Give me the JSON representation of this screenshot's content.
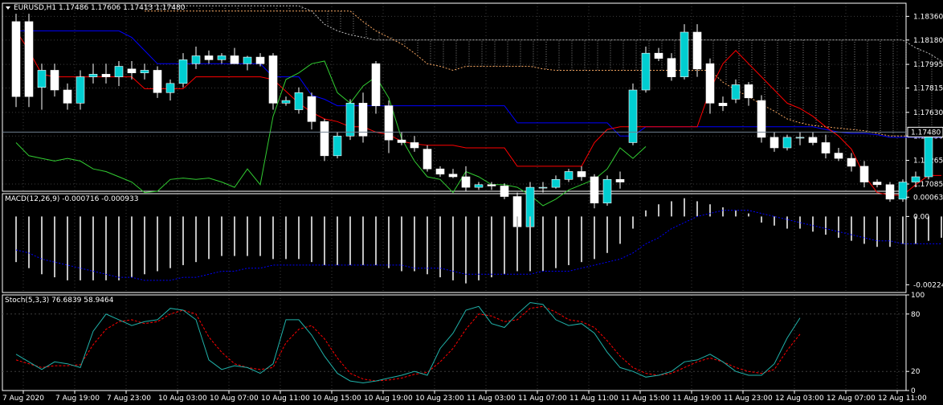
{
  "main": {
    "symbol_header": "EURUSD,H1  1.17486 1.17606 1.17413 1.17480",
    "price_ticks": [
      "1.18360",
      "1.18180",
      "1.17995",
      "1.17815",
      "1.17630",
      "1.17450",
      "1.17265",
      "1.17085"
    ],
    "current_price": "1.17480",
    "ylim": [
      1.1703,
      1.1846
    ]
  },
  "macd": {
    "header": "MACD(12,26,9) -0.000716 -0.000933",
    "ticks": [
      "0.000635",
      "0.00",
      "-0.002245"
    ],
    "ylim": [
      -0.0025,
      0.00075
    ]
  },
  "stoch": {
    "header": "Stoch(5,3,3) 76.6839 58.9464",
    "ticks": [
      "100",
      "80",
      "20",
      "0"
    ],
    "ylim": [
      0,
      100
    ]
  },
  "time_labels": [
    "7 Aug 2020",
    "7 Aug 19:00",
    "7 Aug 23:00",
    "10 Aug 03:00",
    "10 Aug 07:00",
    "10 Aug 11:00",
    "10 Aug 15:00",
    "10 Aug 19:00",
    "10 Aug 23:00",
    "11 Aug 03:00",
    "11 Aug 07:00",
    "11 Aug 11:00",
    "11 Aug 15:00",
    "11 Aug 19:00",
    "11 Aug 23:00",
    "12 Aug 03:00",
    "12 Aug 07:00",
    "12 Aug 11:00"
  ],
  "colors": {
    "background": "#000000",
    "frame": "#ffffff",
    "grid": "#3c3c3c",
    "bull_candle": "#00ced1",
    "bear_candle": "#ffffff",
    "tenkan": "#ff0000",
    "kijun": "#0000ff",
    "chikou": "#32cd32",
    "senkou_a": "#f4a460",
    "senkou_b": "#c0c0c0",
    "macd_hist": "#c0c0c0",
    "macd_signal": "#0000ff",
    "stoch_main": "#20b2aa",
    "stoch_signal": "#ff0000",
    "price_line": "#708090"
  },
  "chart_data": [
    {
      "type": "candlestick",
      "title": "EURUSD,H1",
      "ohlc": [
        [
          1.1832,
          1.1838,
          1.1767,
          1.1775
        ],
        [
          1.1832,
          1.1838,
          1.1767,
          1.1775
        ],
        [
          1.1782,
          1.18,
          1.1765,
          1.1795
        ],
        [
          1.1795,
          1.18,
          1.1775,
          1.178
        ],
        [
          1.178,
          1.1785,
          1.1765,
          1.177
        ],
        [
          1.177,
          1.1795,
          1.1765,
          1.179
        ],
        [
          1.179,
          1.18,
          1.1785,
          1.1792
        ],
        [
          1.1792,
          1.18,
          1.1785,
          1.179
        ],
        [
          1.179,
          1.1802,
          1.1783,
          1.1798
        ],
        [
          1.1796,
          1.1802,
          1.1788,
          1.1793
        ],
        [
          1.1793,
          1.18,
          1.1788,
          1.1795
        ],
        [
          1.1795,
          1.1798,
          1.1774,
          1.1778
        ],
        [
          1.1778,
          1.1788,
          1.1772,
          1.1785
        ],
        [
          1.1785,
          1.1808,
          1.1782,
          1.1803
        ],
        [
          1.18,
          1.1813,
          1.1796,
          1.1806
        ],
        [
          1.1806,
          1.181,
          1.18,
          1.1803
        ],
        [
          1.1803,
          1.1808,
          1.18,
          1.1806
        ],
        [
          1.1806,
          1.1812,
          1.18,
          1.18
        ],
        [
          1.18,
          1.1806,
          1.1795,
          1.1805
        ],
        [
          1.1805,
          1.1808,
          1.1798,
          1.18
        ],
        [
          1.1806,
          1.1808,
          1.1765,
          1.177
        ],
        [
          1.177,
          1.1775,
          1.1768,
          1.1772
        ],
        [
          1.1765,
          1.1782,
          1.1762,
          1.1778
        ],
        [
          1.1775,
          1.1778,
          1.175,
          1.1756
        ],
        [
          1.1756,
          1.1758,
          1.1726,
          1.173
        ],
        [
          1.173,
          1.1748,
          1.1728,
          1.1745
        ],
        [
          1.1745,
          1.1773,
          1.1742,
          1.177
        ],
        [
          1.177,
          1.1778,
          1.174,
          1.1745
        ],
        [
          1.18,
          1.1802,
          1.1762,
          1.1768
        ],
        [
          1.1768,
          1.1772,
          1.1732,
          1.1742
        ],
        [
          1.1742,
          1.1748,
          1.1738,
          1.174
        ],
        [
          1.174,
          1.1745,
          1.1733,
          1.1736
        ],
        [
          1.1735,
          1.1738,
          1.1718,
          1.172
        ],
        [
          1.172,
          1.1722,
          1.1714,
          1.1716
        ],
        [
          1.1716,
          1.172,
          1.1713,
          1.1714
        ],
        [
          1.1714,
          1.1722,
          1.1703,
          1.1706
        ],
        [
          1.1706,
          1.171,
          1.1704,
          1.1708
        ],
        [
          1.1708,
          1.171,
          1.1704,
          1.1707
        ],
        [
          1.1707,
          1.1709,
          1.1697,
          1.1699
        ],
        [
          1.1699,
          1.1702,
          1.1672,
          1.1676
        ],
        [
          1.1676,
          1.171,
          1.1674,
          1.1706
        ],
        [
          1.1706,
          1.171,
          1.1702,
          1.1706
        ],
        [
          1.1706,
          1.1715,
          1.1705,
          1.1712
        ],
        [
          1.1712,
          1.172,
          1.171,
          1.1718
        ],
        [
          1.1718,
          1.1722,
          1.1711,
          1.1714
        ],
        [
          1.1714,
          1.1716,
          1.169,
          1.1694
        ],
        [
          1.1694,
          1.1715,
          1.1692,
          1.1712
        ],
        [
          1.1712,
          1.1718,
          1.1705,
          1.171
        ],
        [
          1.174,
          1.1785,
          1.1738,
          1.178
        ],
        [
          1.178,
          1.1813,
          1.1778,
          1.1808
        ],
        [
          1.1808,
          1.1812,
          1.1802,
          1.1804
        ],
        [
          1.1804,
          1.1808,
          1.1787,
          1.179
        ],
        [
          1.179,
          1.183,
          1.1788,
          1.1824
        ],
        [
          1.1824,
          1.183,
          1.179,
          1.1796
        ],
        [
          1.18,
          1.1804,
          1.1762,
          1.177
        ],
        [
          1.177,
          1.1775,
          1.1764,
          1.1768
        ],
        [
          1.1773,
          1.1788,
          1.177,
          1.1784
        ],
        [
          1.1784,
          1.1786,
          1.1768,
          1.1774
        ],
        [
          1.1772,
          1.1776,
          1.174,
          1.1744
        ],
        [
          1.1744,
          1.1748,
          1.1733,
          1.1736
        ],
        [
          1.1736,
          1.1746,
          1.1734,
          1.1744
        ],
        [
          1.1744,
          1.1748,
          1.1738,
          1.1744
        ],
        [
          1.1744,
          1.1748,
          1.1738,
          1.174
        ],
        [
          1.174,
          1.1746,
          1.1728,
          1.1732
        ],
        [
          1.1732,
          1.1736,
          1.1726,
          1.1728
        ],
        [
          1.1728,
          1.1732,
          1.1718,
          1.1722
        ],
        [
          1.1722,
          1.1726,
          1.1706,
          1.171
        ],
        [
          1.171,
          1.1712,
          1.1706,
          1.1708
        ],
        [
          1.1708,
          1.171,
          1.1695,
          1.1697
        ],
        [
          1.1697,
          1.1712,
          1.1695,
          1.171
        ],
        [
          1.171,
          1.1718,
          1.1706,
          1.1714
        ],
        [
          1.1714,
          1.1752,
          1.1712,
          1.1748
        ],
        [
          1.1748,
          1.1752,
          1.1745,
          1.1749
        ]
      ],
      "tenkan": [
        1.1825,
        1.181,
        1.1792,
        1.179,
        1.179,
        1.179,
        1.179,
        1.179,
        1.179,
        1.179,
        1.1781,
        1.1781,
        1.1781,
        1.1781,
        1.179,
        1.179,
        1.179,
        1.179,
        1.179,
        1.179,
        1.1788,
        1.1779,
        1.177,
        1.1763,
        1.1758,
        1.1756,
        1.1752,
        1.1752,
        1.1748,
        1.1746,
        1.1741,
        1.1739,
        1.1738,
        1.1738,
        1.1738,
        1.1736,
        1.1736,
        1.1736,
        1.1736,
        1.1722,
        1.1722,
        1.1722,
        1.1722,
        1.1722,
        1.1722,
        1.174,
        1.175,
        1.1752,
        1.1752,
        1.1752,
        1.1752,
        1.1752,
        1.1752,
        1.1752,
        1.178,
        1.18,
        1.181,
        1.18,
        1.179,
        1.178,
        1.177,
        1.1766,
        1.176,
        1.1752,
        1.1745,
        1.1735,
        1.1715,
        1.1702,
        1.17,
        1.17,
        1.1708,
        1.1715,
        1.1715
      ],
      "kijun": [
        1.1825,
        1.1825,
        1.1825,
        1.1825,
        1.1825,
        1.1825,
        1.1825,
        1.1825,
        1.1825,
        1.182,
        1.181,
        1.18,
        1.18,
        1.18,
        1.18,
        1.18,
        1.18,
        1.18,
        1.18,
        1.18,
        1.179,
        1.179,
        1.179,
        1.1776,
        1.1773,
        1.1768,
        1.1768,
        1.1768,
        1.1768,
        1.1768,
        1.1768,
        1.1768,
        1.1768,
        1.1768,
        1.1768,
        1.1768,
        1.1768,
        1.1768,
        1.1768,
        1.1755,
        1.1755,
        1.1755,
        1.1755,
        1.1755,
        1.1755,
        1.1755,
        1.1755,
        1.1745,
        1.1745,
        1.1752,
        1.1752,
        1.1752,
        1.1752,
        1.1752,
        1.1752,
        1.1752,
        1.1752,
        1.1752,
        1.1752,
        1.1752,
        1.1752,
        1.1752,
        1.1752,
        1.175,
        1.1748,
        1.1747,
        1.1747,
        1.1746,
        1.1744,
        1.1744,
        1.1744,
        1.1744,
        1.1744
      ],
      "chikou": [
        1.174,
        1.173,
        1.1728,
        1.1726,
        1.1728,
        1.1726,
        1.172,
        1.1718,
        1.1714,
        1.171,
        1.1702,
        1.1703,
        1.1712,
        1.1713,
        1.1712,
        1.1713,
        1.171,
        1.1706,
        1.172,
        1.1708,
        1.176,
        1.1788,
        1.1793,
        1.18,
        1.1802,
        1.1778,
        1.177,
        1.1783,
        1.179,
        1.1774,
        1.1743,
        1.1726,
        1.1714,
        1.1712,
        1.1702,
        1.1718,
        1.1714,
        1.1708,
        1.1708,
        1.1706,
        1.17,
        1.1692,
        1.1697,
        1.1704,
        1.1708,
        1.1712,
        1.172,
        1.1736,
        1.1728,
        1.1737
      ],
      "senkou_a": [
        null,
        null,
        null,
        null,
        null,
        null,
        null,
        null,
        null,
        null,
        1.184,
        1.184,
        1.184,
        1.184,
        1.184,
        1.184,
        1.184,
        1.184,
        1.184,
        1.184,
        1.184,
        1.184,
        1.184,
        1.184,
        1.184,
        1.184,
        1.184,
        1.1832,
        1.1825,
        1.182,
        1.1815,
        1.1808,
        1.18,
        1.1798,
        1.1795,
        1.1798,
        1.1798,
        1.1798,
        1.1798,
        1.1798,
        1.1798,
        1.1796,
        1.1795,
        1.1795,
        1.1795,
        1.1795,
        1.1795,
        1.1795,
        1.1795,
        1.1795,
        1.1795,
        1.1795,
        1.1795,
        1.1795,
        1.1795,
        1.1786,
        1.178,
        1.1775,
        1.1769,
        1.1764,
        1.1758,
        1.1755,
        1.1753,
        1.1752,
        1.1751,
        1.175,
        1.1749,
        1.1747,
        1.1745,
        1.1745,
        1.1745,
        1.1746,
        1.1748,
        1.175
      ],
      "senkou_b": [
        null,
        null,
        null,
        null,
        null,
        null,
        null,
        null,
        null,
        null,
        1.1844,
        1.1844,
        1.1844,
        1.1844,
        1.1844,
        1.1844,
        1.1844,
        1.1844,
        1.1844,
        1.1844,
        1.1844,
        1.1844,
        1.1844,
        1.184,
        1.183,
        1.1825,
        1.1822,
        1.182,
        1.1818,
        1.1818,
        1.1818,
        1.1818,
        1.1818,
        1.1818,
        1.1818,
        1.1818,
        1.1818,
        1.1818,
        1.1818,
        1.1818,
        1.1818,
        1.1818,
        1.1818,
        1.1818,
        1.1818,
        1.1818,
        1.1818,
        1.1818,
        1.1818,
        1.1818,
        1.1818,
        1.1818,
        1.1818,
        1.1818,
        1.1818,
        1.1818,
        1.1818,
        1.1818,
        1.1818,
        1.1818,
        1.1818,
        1.1818,
        1.1818,
        1.1818,
        1.1818,
        1.1818,
        1.1818,
        1.1818,
        1.1818,
        1.1818,
        1.1812,
        1.1808,
        1.1802,
        1.18
      ]
    },
    {
      "type": "bar",
      "title": "MACD(12,26,9)",
      "macd_hist": [
        -0.0015,
        -0.0017,
        -0.0019,
        -0.002,
        -0.0021,
        -0.0021,
        -0.0021,
        -0.0021,
        -0.0021,
        -0.002,
        -0.0019,
        -0.0018,
        -0.0017,
        -0.0016,
        -0.0015,
        -0.0014,
        -0.0013,
        -0.0013,
        -0.0013,
        -0.0013,
        -0.0014,
        -0.0014,
        -0.0014,
        -0.0015,
        -0.0016,
        -0.0016,
        -0.0016,
        -0.0016,
        -0.0016,
        -0.0017,
        -0.0018,
        -0.0018,
        -0.0019,
        -0.002,
        -0.0021,
        -0.0022,
        -0.0021,
        -0.002,
        -0.0019,
        -0.0018,
        -0.0018,
        -0.0018,
        -0.0017,
        -0.0016,
        -0.0015,
        -0.0014,
        -0.0012,
        -0.0009,
        -0.0004,
        0.0002,
        0.0004,
        0.0005,
        0.0006,
        0.0005,
        0.0004,
        0.0003,
        0.0002,
        0.0001,
        -0.0002,
        -0.0003,
        -0.0004,
        -0.0004,
        -0.0005,
        -0.0006,
        -0.0007,
        -0.0008,
        -0.0009,
        -0.001,
        -0.001,
        -0.0009,
        -0.0009,
        -0.0008,
        -0.0007
      ],
      "macd_signal": [
        -0.0011,
        -0.0012,
        -0.0014,
        -0.0015,
        -0.0016,
        -0.0017,
        -0.0018,
        -0.0019,
        -0.002,
        -0.002,
        -0.0021,
        -0.0021,
        -0.0021,
        -0.002,
        -0.002,
        -0.0019,
        -0.0018,
        -0.0018,
        -0.0017,
        -0.0017,
        -0.0016,
        -0.0016,
        -0.0016,
        -0.0016,
        -0.0016,
        -0.0016,
        -0.0016,
        -0.0016,
        -0.0016,
        -0.0016,
        -0.0016,
        -0.0017,
        -0.0017,
        -0.0017,
        -0.0018,
        -0.0019,
        -0.0019,
        -0.0019,
        -0.0019,
        -0.0019,
        -0.0019,
        -0.0018,
        -0.0018,
        -0.0018,
        -0.0017,
        -0.0016,
        -0.0015,
        -0.0014,
        -0.0012,
        -0.0009,
        -0.0007,
        -0.0004,
        -0.0002,
        0.0,
        0.0001,
        0.0002,
        0.0002,
        0.0002,
        0.0001,
        0.0,
        -0.0001,
        -0.0002,
        -0.0003,
        -0.0004,
        -0.0005,
        -0.0006,
        -0.0007,
        -0.0008,
        -0.0008,
        -0.0009,
        -0.0009,
        -0.0009,
        -0.0009
      ]
    },
    {
      "type": "line",
      "title": "Stoch(5,3,3)",
      "ylim": [
        0,
        100
      ],
      "stoch_main": [
        38,
        30,
        22,
        30,
        28,
        24,
        62,
        80,
        74,
        68,
        72,
        74,
        86,
        84,
        74,
        32,
        22,
        26,
        24,
        18,
        28,
        74,
        74,
        58,
        36,
        18,
        10,
        8,
        10,
        13,
        16,
        20,
        16,
        44,
        60,
        84,
        88,
        70,
        66,
        80,
        92,
        90,
        74,
        68,
        70,
        60,
        40,
        24,
        20,
        14,
        16,
        20,
        30,
        32,
        38,
        30,
        20,
        16,
        16,
        28,
        55,
        76
      ],
      "stoch_signal": [
        32,
        28,
        24,
        26,
        26,
        27,
        48,
        64,
        72,
        74,
        70,
        72,
        80,
        84,
        80,
        56,
        40,
        28,
        24,
        22,
        24,
        50,
        64,
        68,
        54,
        34,
        18,
        12,
        10,
        11,
        13,
        17,
        19,
        30,
        44,
        64,
        80,
        78,
        72,
        74,
        86,
        88,
        82,
        74,
        72,
        66,
        52,
        36,
        24,
        18,
        16,
        18,
        24,
        30,
        34,
        30,
        24,
        20,
        18,
        22,
        42,
        59
      ]
    }
  ]
}
